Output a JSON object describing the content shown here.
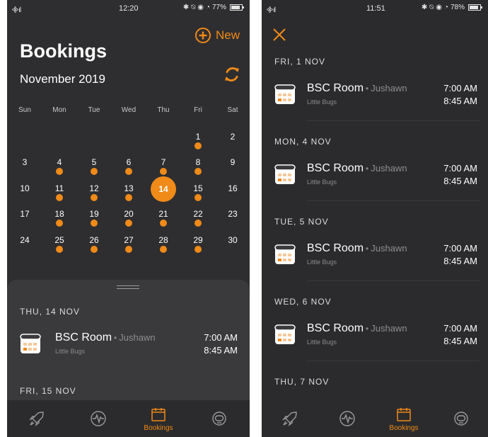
{
  "colors": {
    "accent": "#f08a18",
    "background": "#2e2e30",
    "sheet": "#3a3a3c"
  },
  "left": {
    "status": {
      "signal": "᯽ıl",
      "time": "12:20",
      "battery": "77%",
      "battery_level": 0.77
    },
    "title": "Bookings",
    "new_label": "New",
    "month": "November 2019",
    "weekdays": [
      "Sun",
      "Mon",
      "Tue",
      "Wed",
      "Thu",
      "Fri",
      "Sat"
    ],
    "calendar": {
      "weeks": [
        [
          null,
          null,
          null,
          null,
          null,
          1,
          2
        ],
        [
          3,
          4,
          5,
          6,
          7,
          8,
          9
        ],
        [
          10,
          11,
          12,
          13,
          14,
          15,
          16
        ],
        [
          17,
          18,
          19,
          20,
          21,
          22,
          23
        ],
        [
          24,
          25,
          26,
          27,
          28,
          29,
          30
        ]
      ],
      "booked_days": [
        1,
        4,
        5,
        6,
        7,
        8,
        11,
        12,
        13,
        14,
        15,
        18,
        19,
        20,
        21,
        22,
        25,
        26,
        27,
        28,
        29
      ],
      "selected_day": 14
    },
    "sheet": {
      "sections": [
        {
          "heading": "THU, 14 NOV",
          "bookings": [
            {
              "room": "BSC Room",
              "separator": "•",
              "person": "Jushawn",
              "org": "Little Bugs",
              "start": "7:00 AM",
              "end": "8:45 AM"
            }
          ]
        },
        {
          "heading": "FRI, 15 NOV",
          "bookings": []
        }
      ]
    },
    "tabs": [
      {
        "icon": "rocket-icon",
        "label": ""
      },
      {
        "icon": "activity-icon",
        "label": ""
      },
      {
        "icon": "calendar-icon",
        "label": "Bookings",
        "active": true
      },
      {
        "icon": "astronaut-icon",
        "label": ""
      }
    ]
  },
  "right": {
    "status": {
      "signal": "᯽ıl",
      "time": "11:51",
      "battery": "78%",
      "battery_level": 0.78
    },
    "sections": [
      {
        "heading": "FRI, 1 NOV",
        "bookings": [
          {
            "room": "BSC Room",
            "separator": "•",
            "person": "Jushawn",
            "org": "Little Bugs",
            "start": "7:00 AM",
            "end": "8:45 AM"
          }
        ]
      },
      {
        "heading": "MON, 4 NOV",
        "bookings": [
          {
            "room": "BSC Room",
            "separator": "•",
            "person": "Jushawn",
            "org": "Little Bugs",
            "start": "7:00 AM",
            "end": "8:45 AM"
          }
        ]
      },
      {
        "heading": "TUE, 5 NOV",
        "bookings": [
          {
            "room": "BSC Room",
            "separator": "•",
            "person": "Jushawn",
            "org": "Little Bugs",
            "start": "7:00 AM",
            "end": "8:45 AM"
          }
        ]
      },
      {
        "heading": "WED, 6 NOV",
        "bookings": [
          {
            "room": "BSC Room",
            "separator": "•",
            "person": "Jushawn",
            "org": "Little Bugs",
            "start": "7:00 AM",
            "end": "8:45 AM"
          }
        ]
      },
      {
        "heading": "THU, 7 NOV",
        "bookings": []
      }
    ],
    "tabs": [
      {
        "icon": "rocket-icon",
        "label": ""
      },
      {
        "icon": "activity-icon",
        "label": ""
      },
      {
        "icon": "calendar-icon",
        "label": "Bookings",
        "active": true
      },
      {
        "icon": "astronaut-icon",
        "label": ""
      }
    ]
  }
}
